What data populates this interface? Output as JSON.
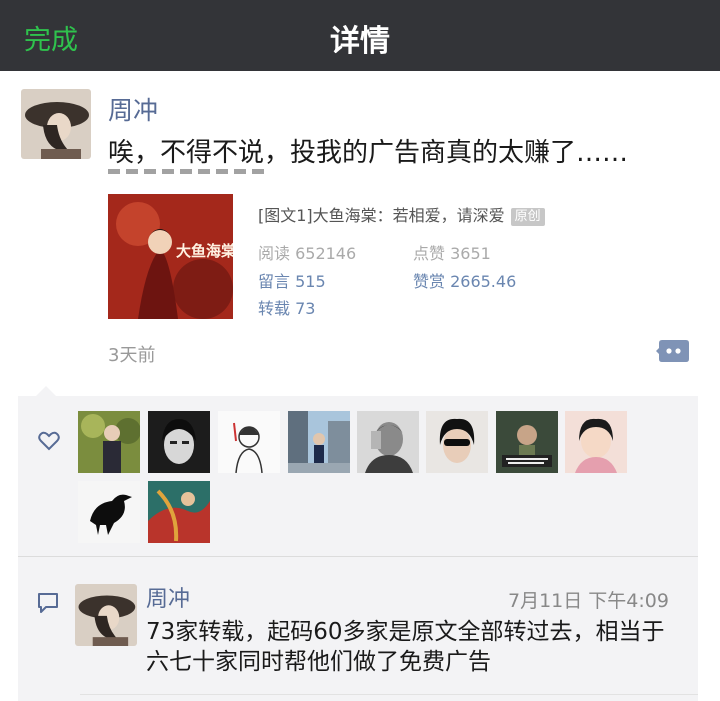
{
  "navbar": {
    "done_label": "完成",
    "title": "详情"
  },
  "post": {
    "author": "周冲",
    "text": "唉，不得不说，投我的广告商真的太赚了……",
    "timestamp": "3天前"
  },
  "shared_article": {
    "title": "[图文1]大鱼海棠：若相爱，请深爱",
    "original_tag": "原创",
    "thumb_caption": "大鱼海棠",
    "stats": {
      "reads": "阅读 652146",
      "likes": "点赞 3651",
      "comments": "留言 515",
      "tips": "赞赏 2665.46",
      "reposts": "转载 73"
    }
  },
  "likes": {
    "icon": "heart-icon",
    "avatars": [
      "avatar-1",
      "avatar-2",
      "avatar-3",
      "avatar-4",
      "avatar-5",
      "avatar-6",
      "avatar-7",
      "avatar-8",
      "avatar-9",
      "avatar-10"
    ]
  },
  "comments": [
    {
      "author": "周冲",
      "time": "7月11日 下午4:09",
      "text": "73家转载，起码60多家是原文全部转过去，相当于六七十家同时帮他们做了免费广告"
    }
  ],
  "colors": {
    "navbar_bg": "#333438",
    "done_green": "#2fc24d",
    "name_blue": "#576b95",
    "panel_bg": "#f3f3f5"
  }
}
